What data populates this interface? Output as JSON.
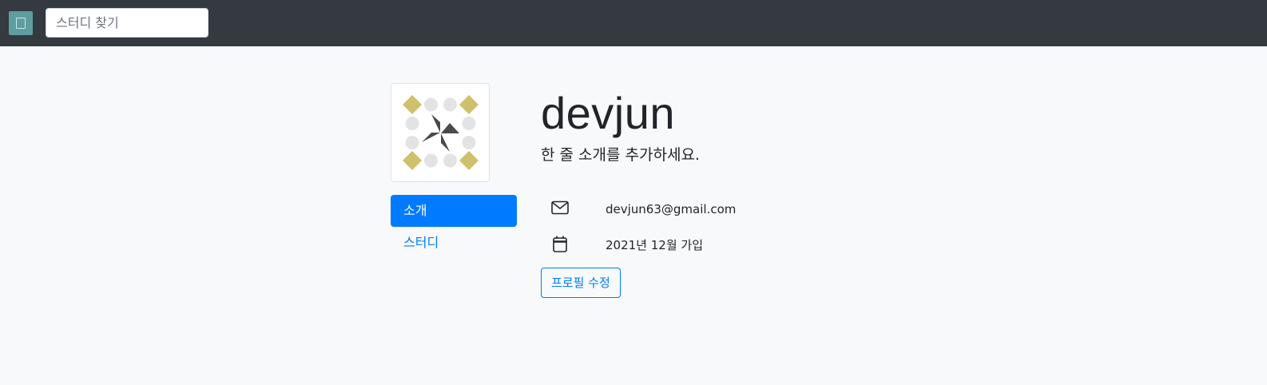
{
  "navbar": {
    "logo_icon": "study-logo-icon",
    "search": {
      "placeholder": "스터디 찾기",
      "value": ""
    }
  },
  "profile": {
    "avatar_icon": "identicon-avatar",
    "username": "devjun",
    "bio": "한 줄 소개를 추가하세요.",
    "tabs": [
      {
        "label": "소개",
        "active": true
      },
      {
        "label": "스터디",
        "active": false
      }
    ],
    "email": {
      "icon": "envelope-icon",
      "text": "devjun63@gmail.com"
    },
    "joined": {
      "icon": "calendar-icon",
      "text": "2021년 12월 가입"
    },
    "edit_button": "프로필 수정"
  },
  "colors": {
    "navbar_bg": "#343a40",
    "primary": "#007bff",
    "page_bg": "#f8f9fa",
    "identicon_accent": "#cfc06b",
    "identicon_dark": "#4a4a4a",
    "identicon_light": "#e3e3e3"
  }
}
